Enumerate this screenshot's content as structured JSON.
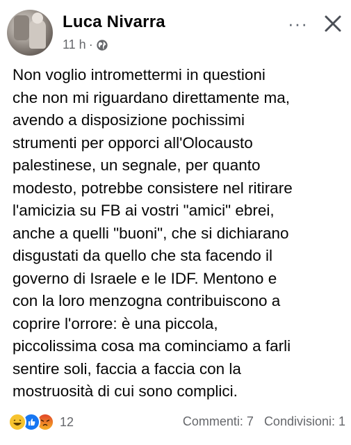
{
  "post": {
    "author": "Luca Nivarra",
    "time": "11 h",
    "separator": "·",
    "text": "Non voglio intromettermi in questioni\nche non mi riguardano direttamente ma,\navendo a disposizione pochissimi\nstrumenti per opporci all'Olocausto\npalestinese, un segnale, per quanto\nmodesto, potrebbe consistere nel ritirare\nl'amicizia su FB ai vostri \"amici\" ebrei,\nanche a quelli \"buoni\", che si dichiarano\ndisgustati da quello che sta facendo il\ngoverno di Israele e le IDF. Mentono e\ncon la loro menzogna contribuiscono a\ncoprire l'orrore: è una piccola,\npiccolissima cosa ma cominciamo a farli\nsentire soli, faccia a faccia con la\nmostruosità di cui sono complici.",
    "more_icon": "···"
  },
  "footer": {
    "reactions": [
      "haha",
      "like",
      "angry"
    ],
    "reaction_count": "12",
    "comments": "Commenti: 7",
    "shares": "Condivisioni: 1"
  },
  "colors": {
    "secondary_text": "#65676b",
    "like_blue": "#1877f2",
    "haha_yellow": "#f7c32f",
    "angry_orange": "#e9710f"
  }
}
